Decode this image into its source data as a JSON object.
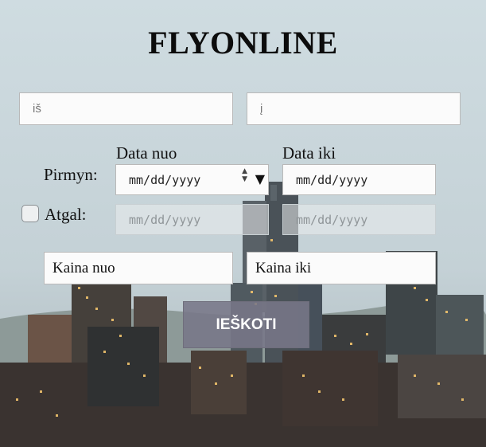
{
  "app": {
    "title": "FLYONLINE"
  },
  "route": {
    "from_placeholder": "iš",
    "to_placeholder": "į"
  },
  "dates": {
    "from_label": "Data nuo",
    "to_label": "Data iki",
    "outbound_label": "Pirmyn:",
    "return_label": "Atgal:",
    "outbound_from": "mm/dd/yyyy",
    "outbound_to": "mm/dd/yyyy",
    "return_from": "mm/dd/yyyy",
    "return_to": "mm/dd/yyyy",
    "return_checked": false
  },
  "price": {
    "min_placeholder": "Kaina nuo",
    "max_placeholder": "Kaina iki"
  },
  "search": {
    "button_label": "IEŠKOTI"
  },
  "colors": {
    "button": "#7a7887",
    "title": "#0c0c0c"
  }
}
